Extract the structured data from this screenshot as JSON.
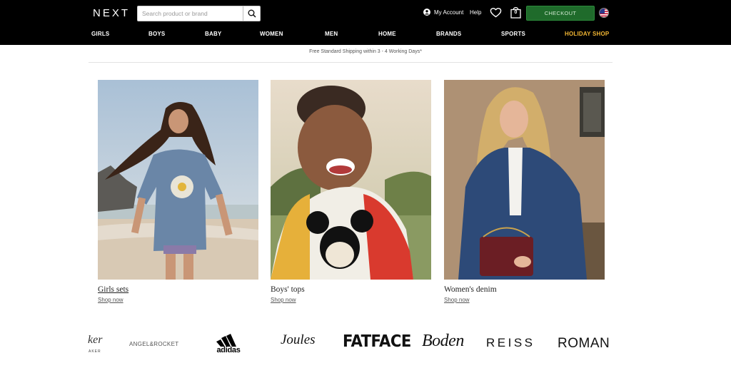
{
  "header": {
    "logo": "NEXT",
    "search_placeholder": "Search product or brand",
    "account_label": "My Account",
    "help_label": "Help",
    "bag_count": "0",
    "checkout_label": "CHECKOUT",
    "icons": [
      "search-icon",
      "user-icon",
      "heart-icon",
      "bag-icon",
      "us-flag-icon"
    ]
  },
  "nav": {
    "items": [
      "GIRLS",
      "BOYS",
      "BABY",
      "WOMEN",
      "MEN",
      "HOME",
      "BRANDS",
      "SPORTS",
      "HOLIDAY SHOP"
    ],
    "holiday_color": "#f2b633"
  },
  "shipping_text": "Free Standard Shipping within 3 - 4 Working Days*",
  "tiles": [
    {
      "title": "Girls sets",
      "link": "Shop now"
    },
    {
      "title": "Boys' tops",
      "link": "Shop now"
    },
    {
      "title": "Women's denim",
      "link": "Shop now"
    }
  ],
  "brands": {
    "partial": "ker",
    "partial_sub": "AKER",
    "angel_rocket": "ANGEL&ROCKET",
    "adidas": "adidas",
    "joules": "Joules",
    "fatface": "FATFACE",
    "boden": "Boden",
    "reiss": "REISS",
    "roman": "ROMAN"
  },
  "colors": {
    "header_bg": "#000000",
    "checkout_bg": "#1f6b2b",
    "holiday": "#f2b633"
  }
}
